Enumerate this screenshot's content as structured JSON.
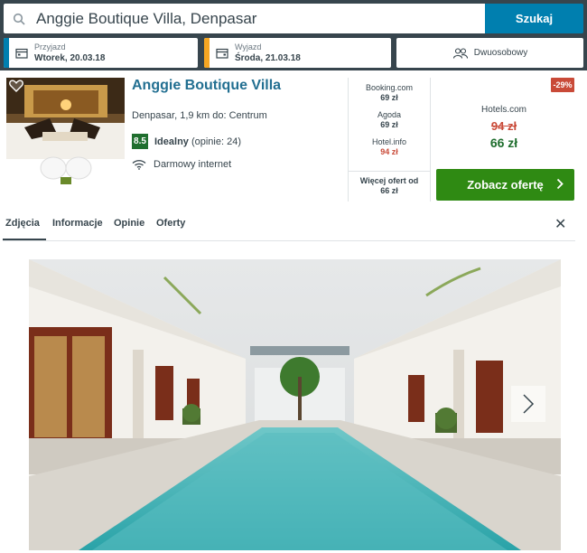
{
  "search": {
    "value": "Anggie Boutique Villa, Denpasar",
    "button": "Szukaj"
  },
  "checkin": {
    "label": "Przyjazd",
    "value": "Wtorek, 20.03.18",
    "accent": "#007faf"
  },
  "checkout": {
    "label": "Wyjazd",
    "value": "Środa, 21.03.18",
    "accent": "#f5a623"
  },
  "room": {
    "label": "Dwuosobowy"
  },
  "hotel": {
    "name": "Anggie Boutique Villa",
    "location": "Denpasar, 1,9 km do: Centrum",
    "rating": "8.5",
    "rating_word": "Idealny",
    "rating_count": "(opinie: 24)",
    "amenity": "Darmowy internet"
  },
  "offers": [
    {
      "site": "Booking.com",
      "price": "69 zł"
    },
    {
      "site": "Agoda",
      "price": "69 zł"
    },
    {
      "site": "Hotel.info",
      "price": "94 zł"
    }
  ],
  "more_offers": {
    "label": "Więcej ofert od",
    "price": "66 zł"
  },
  "deal": {
    "discount": "-29%",
    "site": "Hotels.com",
    "old_price": "94 zł",
    "new_price": "66 zł",
    "cta": "Zobacz ofertę"
  },
  "tabs": [
    "Zdjęcia",
    "Informacje",
    "Opinie",
    "Oferty"
  ],
  "colors": {
    "dark_bar": "#37454d",
    "blue": "#007faf",
    "green": "#2f8a13",
    "red": "#c94a38"
  }
}
